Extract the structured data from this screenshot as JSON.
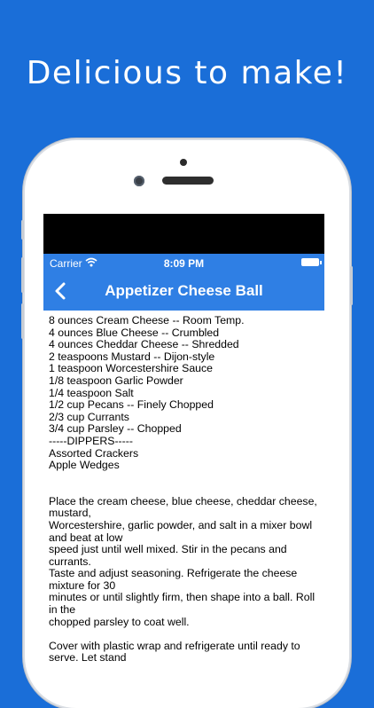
{
  "headline": "Delicious to make!",
  "status_bar": {
    "carrier": "Carrier",
    "time": "8:09 PM"
  },
  "nav": {
    "title": "Appetizer Cheese Ball",
    "back_icon": "chevron-left-icon"
  },
  "recipe": {
    "ingredients": [
      "8 ounces Cream Cheese -- Room Temp.",
      "4 ounces Blue Cheese -- Crumbled",
      "4 ounces Cheddar Cheese -- Shredded",
      "2 teaspoons Mustard -- Dijon-style",
      "1 teaspoon Worcestershire Sauce",
      "1/8 teaspoon Garlic Powder",
      "1/4 teaspoon Salt",
      "1/2 cup Pecans -- Finely Chopped",
      "2/3 cup Currants",
      "3/4 cup Parsley -- Chopped",
      "-----DIPPERS-----",
      "Assorted Crackers",
      "Apple Wedges"
    ],
    "instructions": [
      "Place the cream cheese, blue cheese, cheddar cheese, mustard,",
      "Worcestershire, garlic powder, and salt in a mixer bowl and beat at low",
      "speed just until well mixed. Stir in the pecans and currants.",
      "Taste and adjust seasoning. Refrigerate the cheese mixture for 30",
      "minutes or until slightly firm, then shape into a ball. Roll in the",
      "chopped parsley to coat well."
    ],
    "instructions2": [
      "Cover with plastic wrap and refrigerate until ready to serve. Let stand"
    ]
  },
  "colors": {
    "background": "#1a6ed8",
    "nav": "#2f7fe4"
  }
}
